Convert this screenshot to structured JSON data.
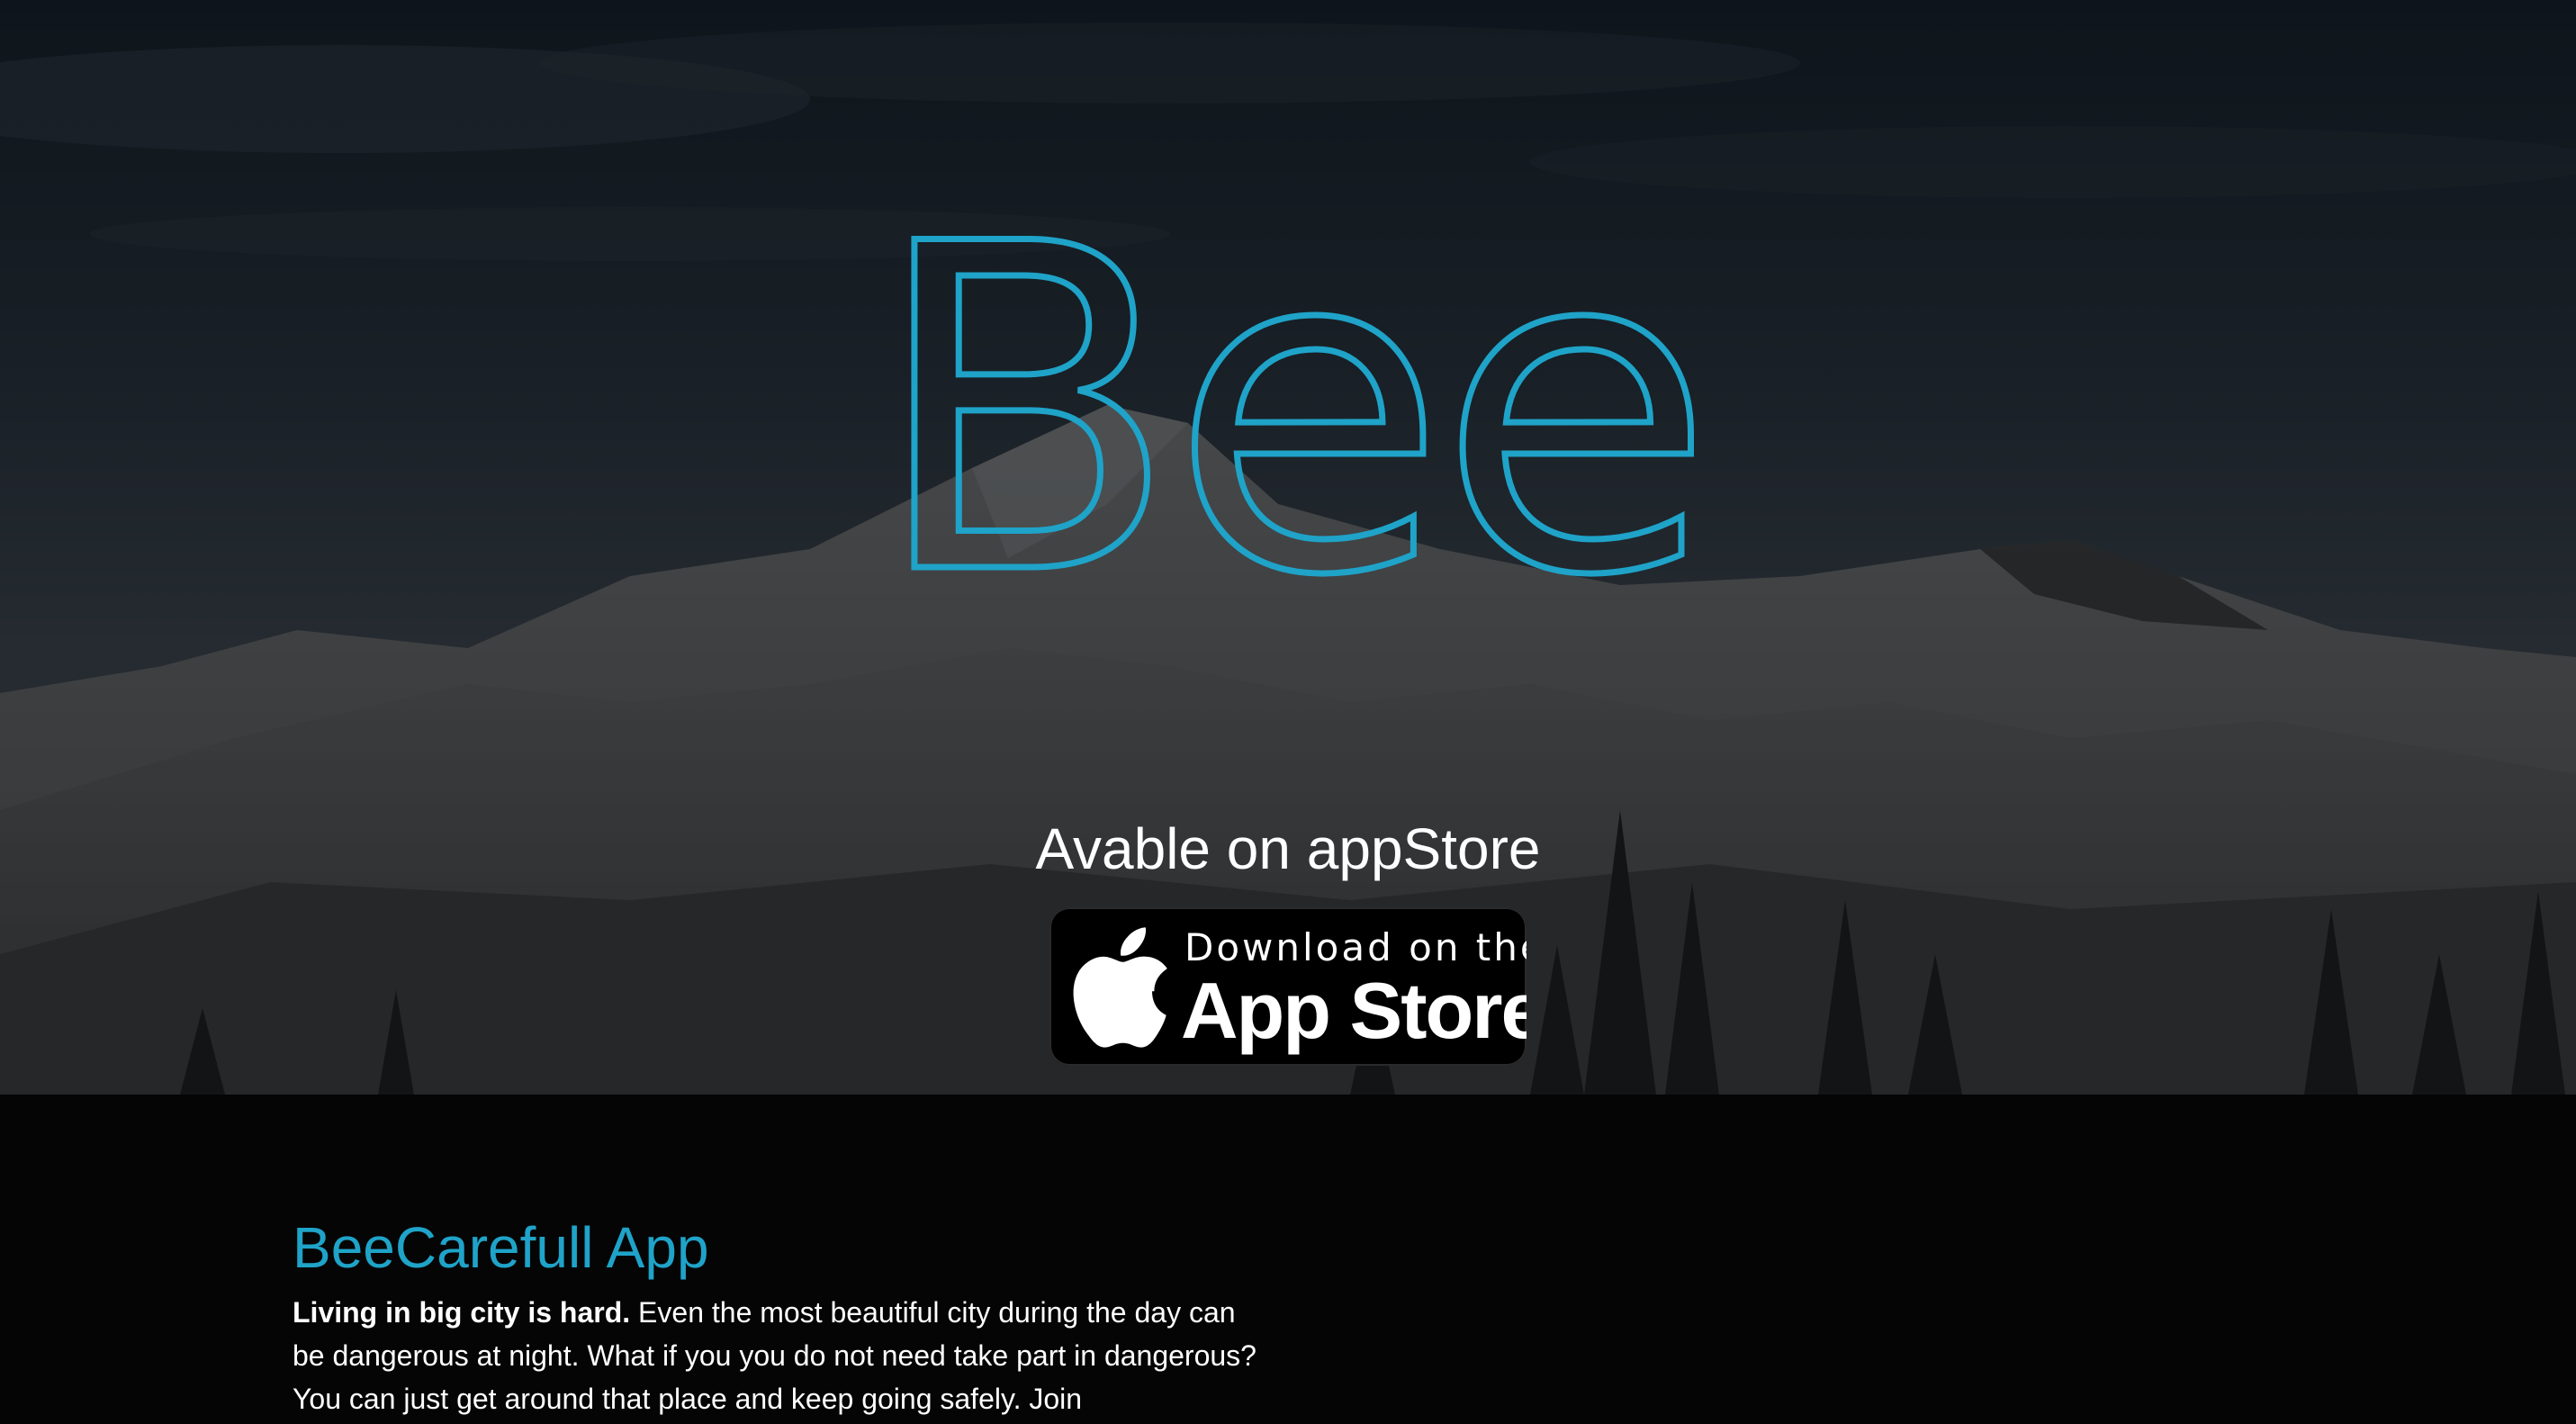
{
  "hero": {
    "logo_text": "Bee",
    "tagline": "Avable on appStore",
    "badge": {
      "line1": "Download on the",
      "line2": "App Store"
    },
    "accent_color": "#1fa3c8",
    "background_icon": "snowy-mountain-photo"
  },
  "about": {
    "title": "BeeCarefull App",
    "lead_bold": "Living in big city is hard.",
    "body": " Even the most beautiful city during the day can be dangerous at night. What if you you do not need take part in dangerous? You can just get around that place and keep going safely. Join"
  }
}
